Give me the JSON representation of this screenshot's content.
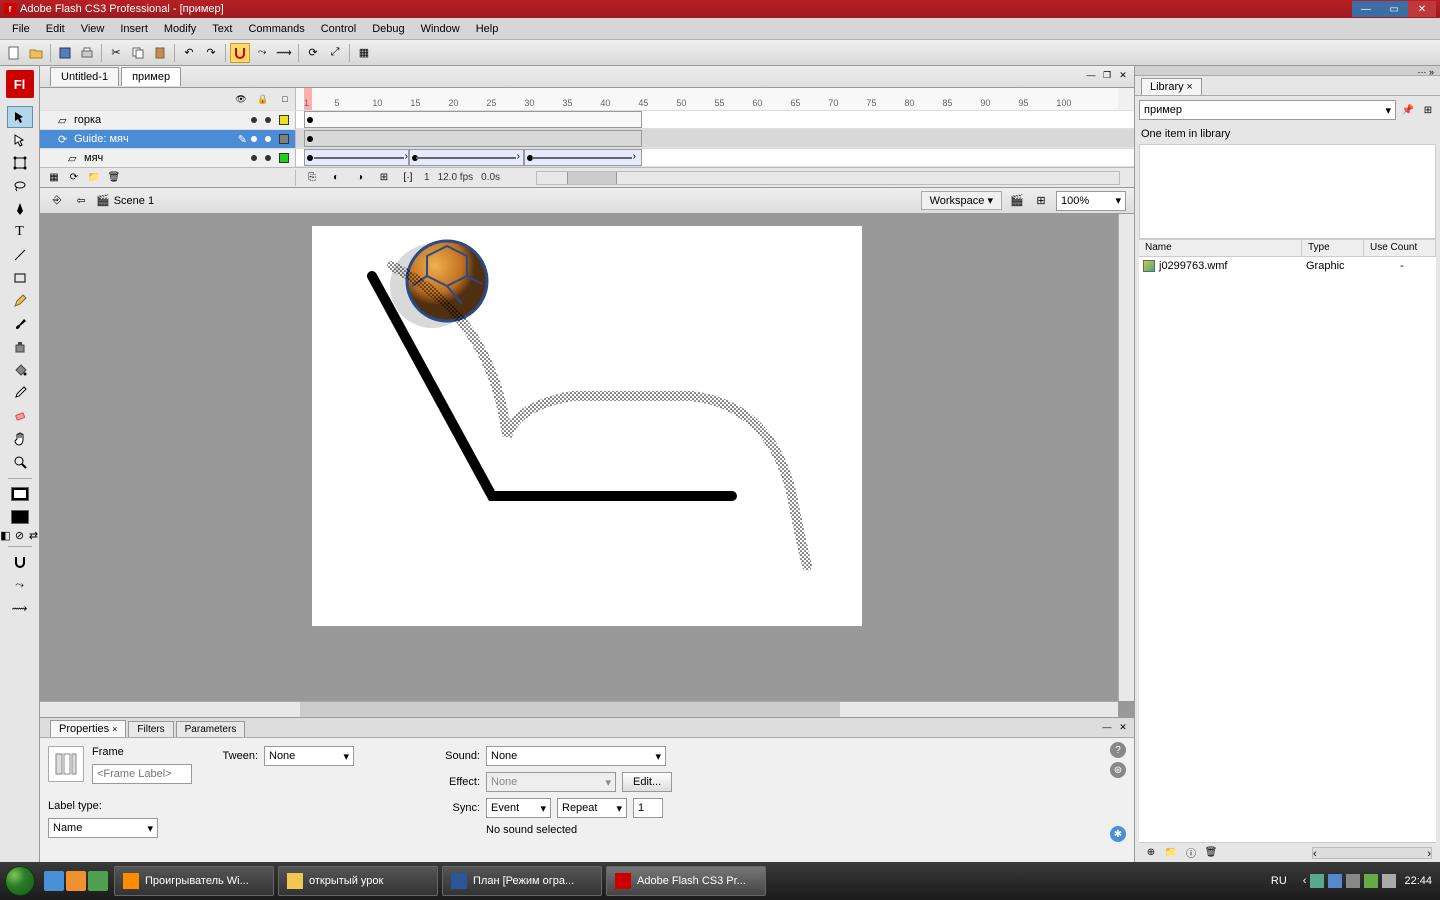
{
  "app": {
    "title": "Adobe Flash CS3 Professional - [пример]",
    "logo": "Fl"
  },
  "menu": [
    "File",
    "Edit",
    "View",
    "Insert",
    "Modify",
    "Text",
    "Commands",
    "Control",
    "Debug",
    "Window",
    "Help"
  ],
  "doc_tabs": {
    "inactive": "Untitled-1",
    "active": "пример"
  },
  "timeline": {
    "layers": [
      {
        "name": "горка",
        "color": "#e8e020",
        "selected": false
      },
      {
        "name": "Guide: мяч",
        "color": "#808080",
        "selected": true,
        "guide": true
      },
      {
        "name": "мяч",
        "color": "#20d020",
        "selected": false
      }
    ],
    "ruler_marks": [
      1,
      5,
      10,
      15,
      20,
      25,
      30,
      35,
      40,
      45,
      50,
      55,
      60,
      65,
      70,
      75,
      80,
      85,
      90,
      95,
      100
    ],
    "status": {
      "frame": "1",
      "fps": "12.0 fps",
      "time": "0.0s"
    }
  },
  "scene": {
    "name": "Scene 1",
    "workspace_label": "Workspace ▾",
    "zoom": "100%"
  },
  "properties": {
    "tabs": [
      "Properties",
      "Filters",
      "Parameters"
    ],
    "frame_label": "Frame",
    "frame_input_placeholder": "<Frame Label>",
    "label_type_label": "Label type:",
    "label_type_value": "Name",
    "tween_label": "Tween:",
    "tween_value": "None",
    "sound_label": "Sound:",
    "sound_value": "None",
    "effect_label": "Effect:",
    "effect_value": "None",
    "edit_btn": "Edit...",
    "sync_label": "Sync:",
    "sync_value": "Event",
    "sync_repeat": "Repeat",
    "sync_count": "1",
    "no_sound": "No sound selected"
  },
  "library": {
    "tab": "Library",
    "doc": "пример",
    "count": "One item in library",
    "cols": {
      "name": "Name",
      "type": "Type",
      "use": "Use Count"
    },
    "items": [
      {
        "name": "j0299763.wmf",
        "type": "Graphic",
        "use": "-"
      }
    ]
  },
  "taskbar": {
    "tasks": [
      {
        "label": "Проигрыватель Wi...",
        "active": false,
        "color": "#ff8c00"
      },
      {
        "label": "открытый урок",
        "active": false,
        "color": "#f0c850"
      },
      {
        "label": "План [Режим огра...",
        "active": false,
        "color": "#2b579a"
      },
      {
        "label": "Adobe Flash CS3 Pr...",
        "active": true,
        "color": "#cc0000"
      }
    ],
    "lang": "RU",
    "time": "22:44"
  }
}
